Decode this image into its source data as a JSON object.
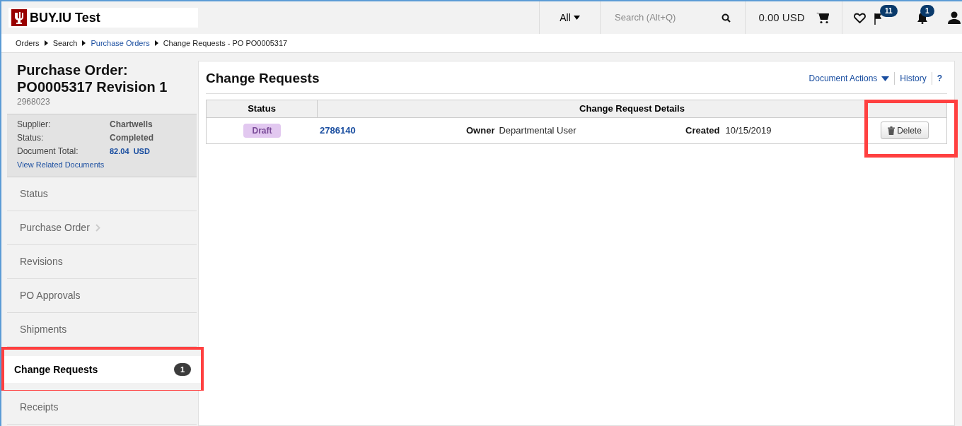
{
  "header": {
    "app_title": "BUY.IU Test",
    "search_scope": "All",
    "search": {
      "placeholder": "Search (Alt+Q)"
    },
    "cart_total": "0.00 USD",
    "flag_count": "11",
    "notification_count": "1"
  },
  "breadcrumbs": [
    {
      "label": "Orders",
      "link": false
    },
    {
      "label": "Search",
      "link": false
    },
    {
      "label": "Purchase Orders",
      "link": true
    },
    {
      "label": "Change Requests - PO PO0005317",
      "link": false
    }
  ],
  "sidebar": {
    "title": "Purchase Order: PO0005317 Revision 1",
    "doc_id": "2968023",
    "summary": [
      {
        "label": "Supplier:",
        "value": "Chartwells",
        "kind": "text"
      },
      {
        "label": "Status:",
        "value": "Completed",
        "kind": "text"
      },
      {
        "label": "Document Total:",
        "value": "82.04  USD",
        "kind": "link"
      }
    ],
    "related_link": "View Related Documents",
    "items": [
      {
        "label": "Status",
        "selected": false,
        "has_chevron": false,
        "highlighted": false
      },
      {
        "label": "Purchase Order",
        "selected": false,
        "has_chevron": true,
        "highlighted": false
      },
      {
        "label": "Revisions",
        "selected": false,
        "has_chevron": false,
        "highlighted": false
      },
      {
        "label": "PO Approvals",
        "selected": false,
        "has_chevron": false,
        "highlighted": false
      },
      {
        "label": "Shipments",
        "selected": false,
        "has_chevron": false,
        "highlighted": false
      },
      {
        "label": "Change Requests",
        "selected": true,
        "has_chevron": false,
        "highlighted": true,
        "badge": "1"
      },
      {
        "label": "Receipts",
        "selected": false,
        "has_chevron": false,
        "highlighted": false
      }
    ]
  },
  "main": {
    "title": "Change Requests",
    "actions": [
      "Document Actions",
      "History",
      "?"
    ],
    "table": {
      "columns": [
        "Status",
        "Change Request Details"
      ],
      "rows": [
        {
          "status": "Draft",
          "number": "2786140",
          "owner_label": "Owner",
          "owner": "Departmental User",
          "created_label": "Created",
          "created": "10/15/2019",
          "action": "Delete",
          "action_highlighted": true
        }
      ]
    }
  }
}
